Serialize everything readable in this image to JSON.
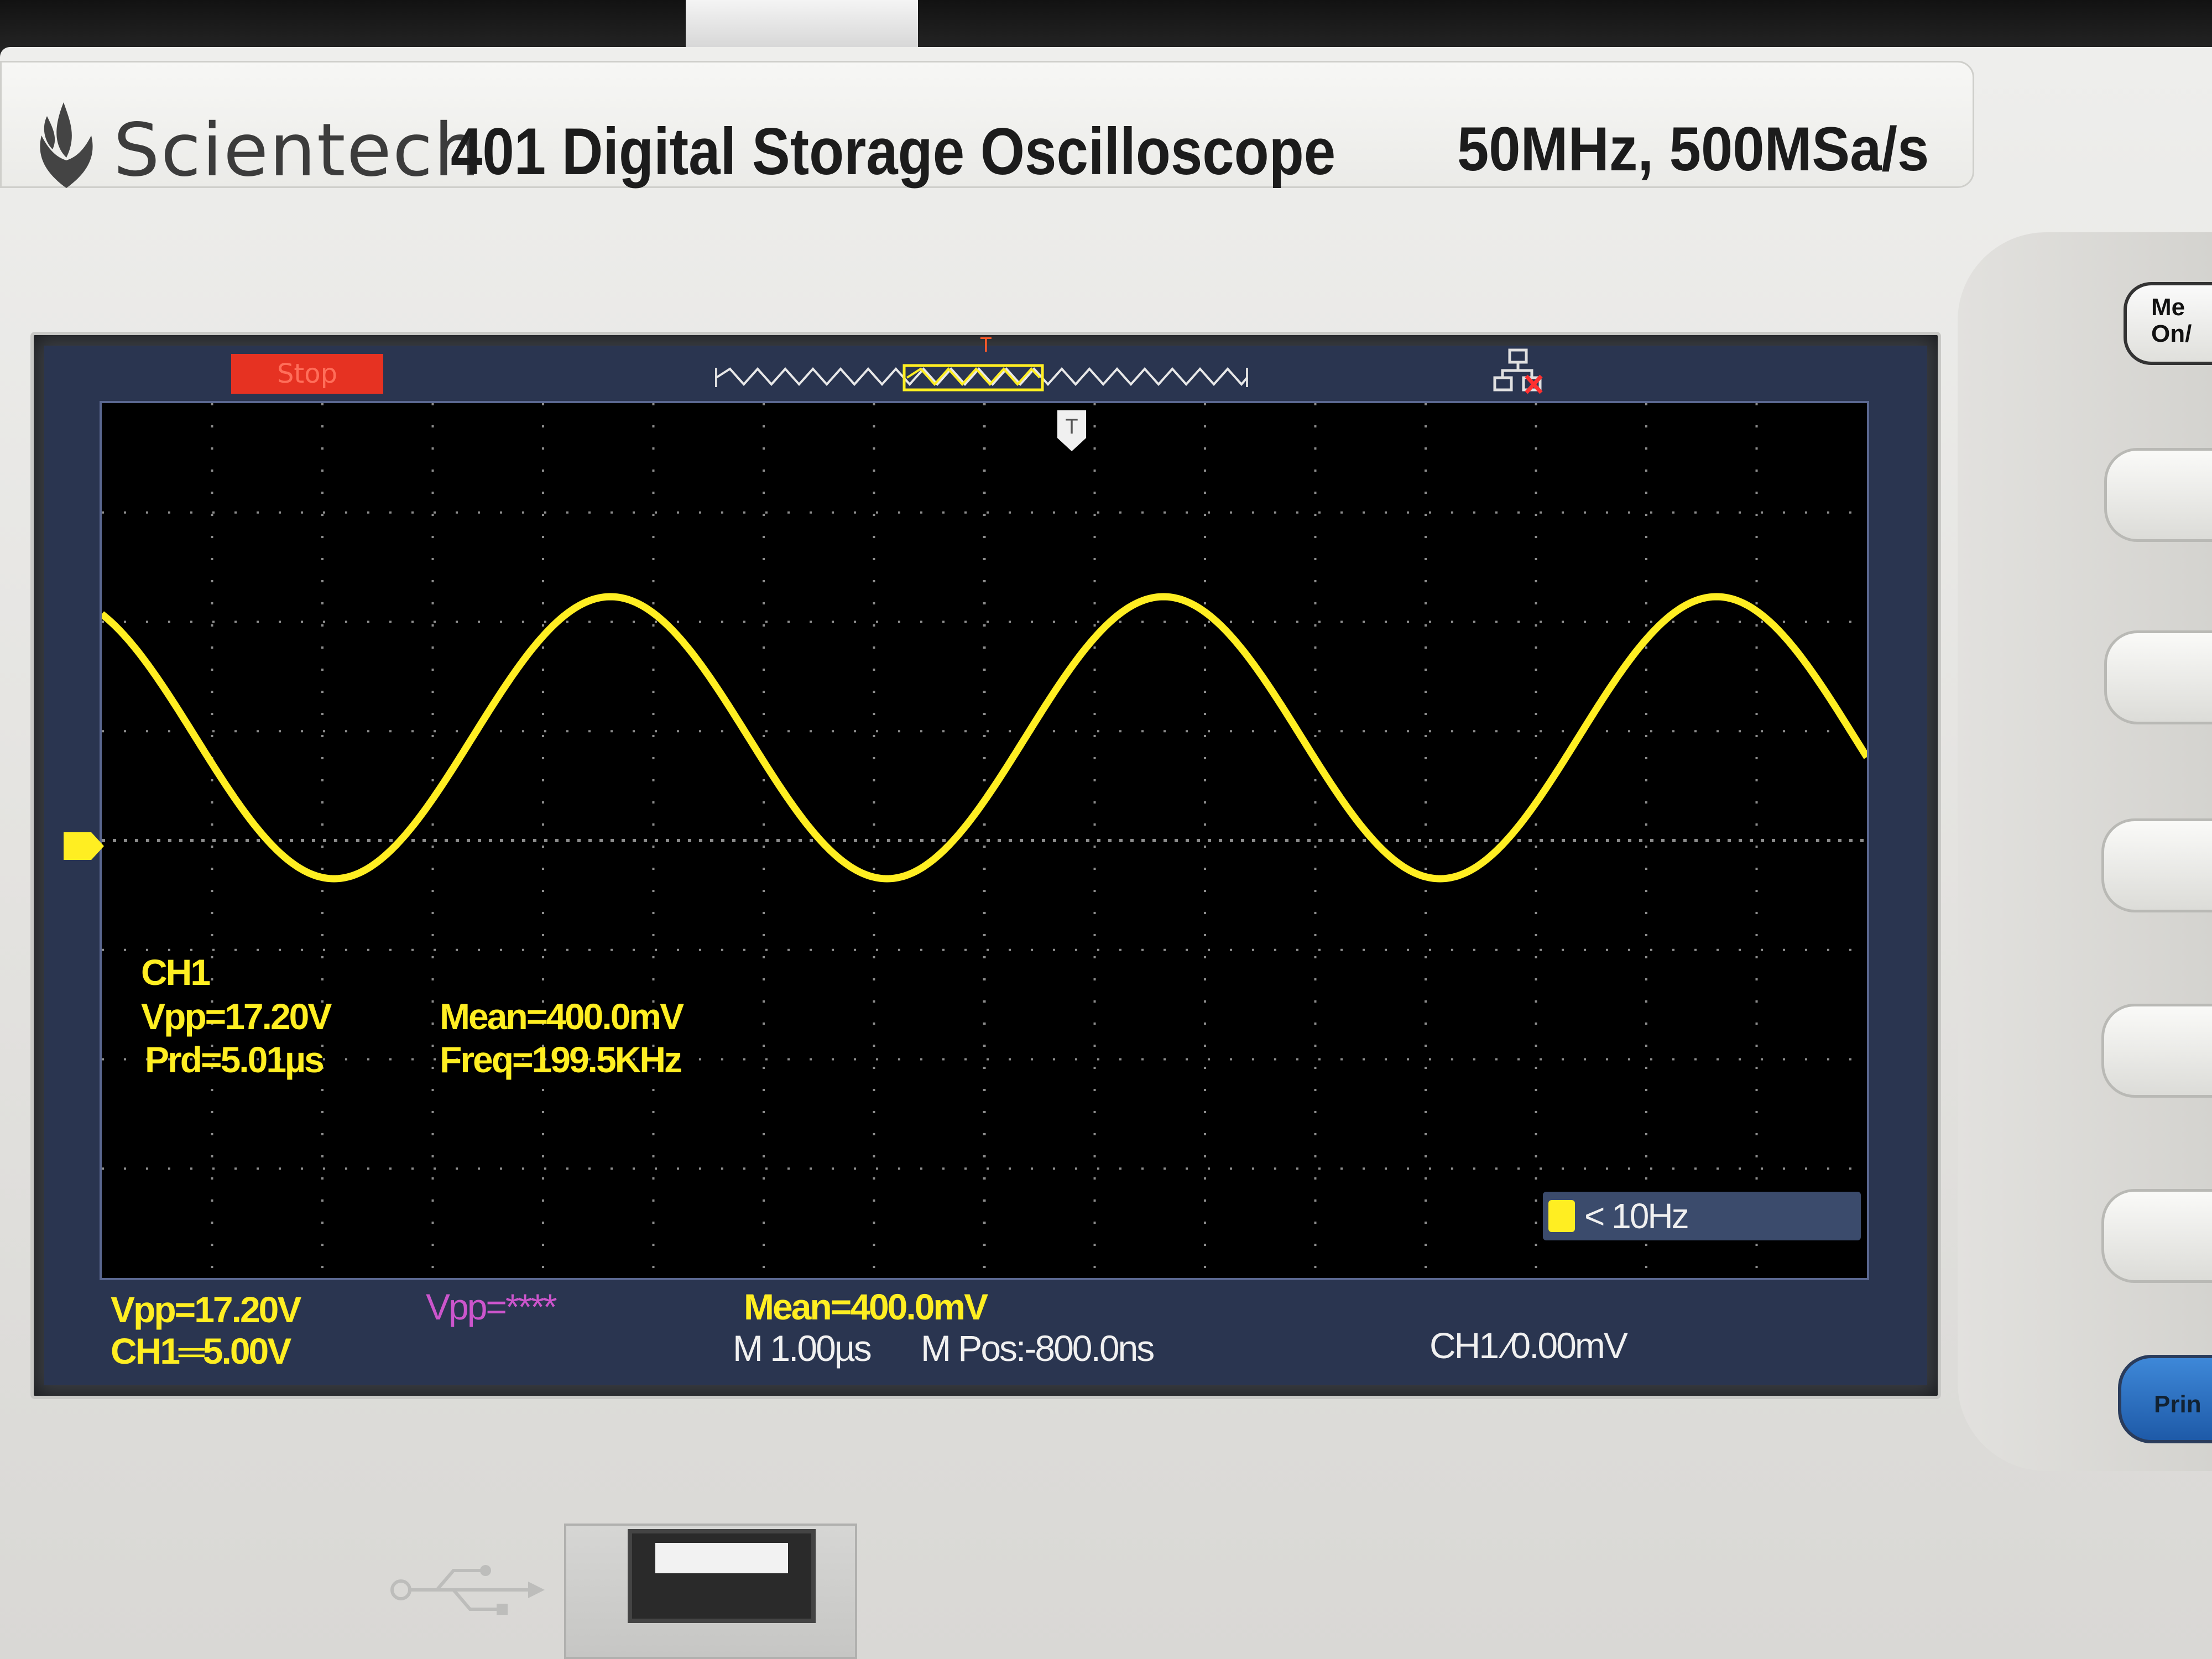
{
  "device": {
    "brand": "Scientech",
    "model": "401 Digital Storage Oscilloscope",
    "spec": "50MHz, 500MSa/s",
    "logo_icon": "flame-leaf-logo-icon"
  },
  "status": {
    "run_state": "Stop",
    "trigger_marker": "T"
  },
  "measurements_overlay": {
    "channel": "CH1",
    "vpp": "Vpp=17.20V",
    "prd": "Prd=5.01µs",
    "mean": "Mean=400.0mV",
    "freq": "Freq=199.5KHz"
  },
  "trigger_freq": "< 10Hz",
  "bottom_bar": {
    "ch1_vpp": "Vpp=17.20V",
    "ch1_scale": "CH1═5.00V",
    "ch2_vpp": "Vpp=****",
    "mean": "Mean=400.0mV",
    "timebase": "M 1.00µs",
    "mpos": "M Pos:-800.0ns",
    "trigger": "CH1 ⁄0.00mV"
  },
  "side_buttons": {
    "menu_label_line1": "Me",
    "menu_label_line2": "On/",
    "print_label": "Prin"
  },
  "colors": {
    "trace": "#ffee22",
    "ch2": "#cc55cc",
    "stop_badge": "#e63222",
    "screen_bg": "#000000"
  }
}
